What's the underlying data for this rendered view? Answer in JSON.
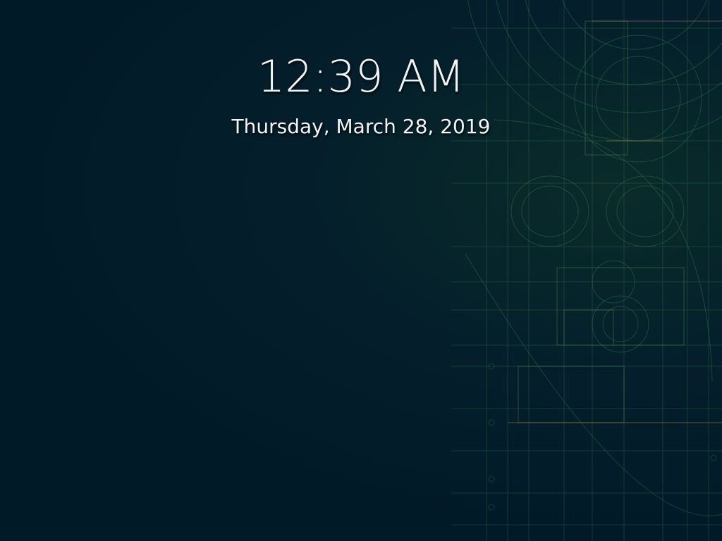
{
  "lock_screen": {
    "time": "12:39 AM",
    "date": "Thursday, March 28, 2019"
  },
  "wallpaper": {
    "background_color": "#011a28",
    "line_color": "#3f8f5a",
    "accent_color": "#6ab04c",
    "warm_line_color": "#8a6a3a"
  }
}
